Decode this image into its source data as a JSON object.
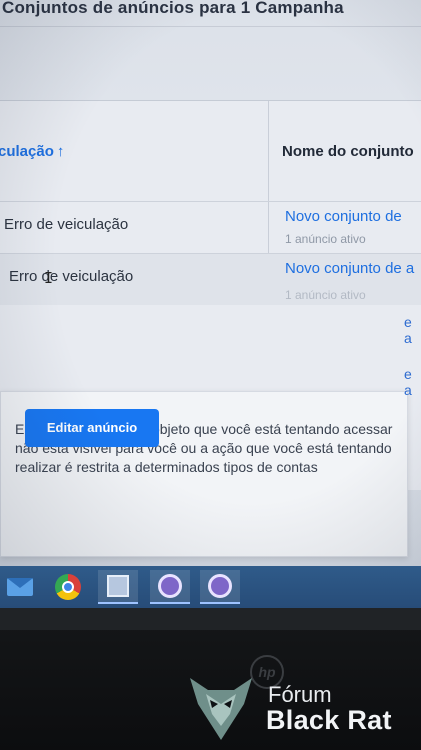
{
  "page": {
    "title": "Conjuntos de anúncios para 1 Campanha"
  },
  "table": {
    "headers": {
      "sorted_column": "culação",
      "sort_arrow": "↑",
      "name_column": "Nome do conjunto"
    },
    "rows": [
      {
        "status": "Erro de veiculação",
        "name": "Novo conjunto de",
        "subtitle": "1 anúncio ativo"
      },
      {
        "status": "Erro de veiculação",
        "name": "Novo conjunto de a",
        "subtitle": "1 anúncio ativo"
      }
    ]
  },
  "tooltip": {
    "message": "Erro de permissão: O objeto que você está tentando acessar não está visível para você ou a ação que você está tentando realizar é restrita a determinados tipos de contas",
    "button_label": "Editar anúncio",
    "peek_1": "e a",
    "peek_2": "e a"
  },
  "taskbar": {
    "items": [
      "mail-icon",
      "chrome-icon",
      "app-icon",
      "round-app-icon",
      "round-app-icon"
    ]
  },
  "laptop": {
    "brand_mark": "hp"
  },
  "watermark": {
    "line1": "Fórum",
    "line2": "Black Rat"
  },
  "colors": {
    "accent": "#1877f2",
    "link": "#1e6fe0",
    "taskbar": "#2f5b8a"
  }
}
